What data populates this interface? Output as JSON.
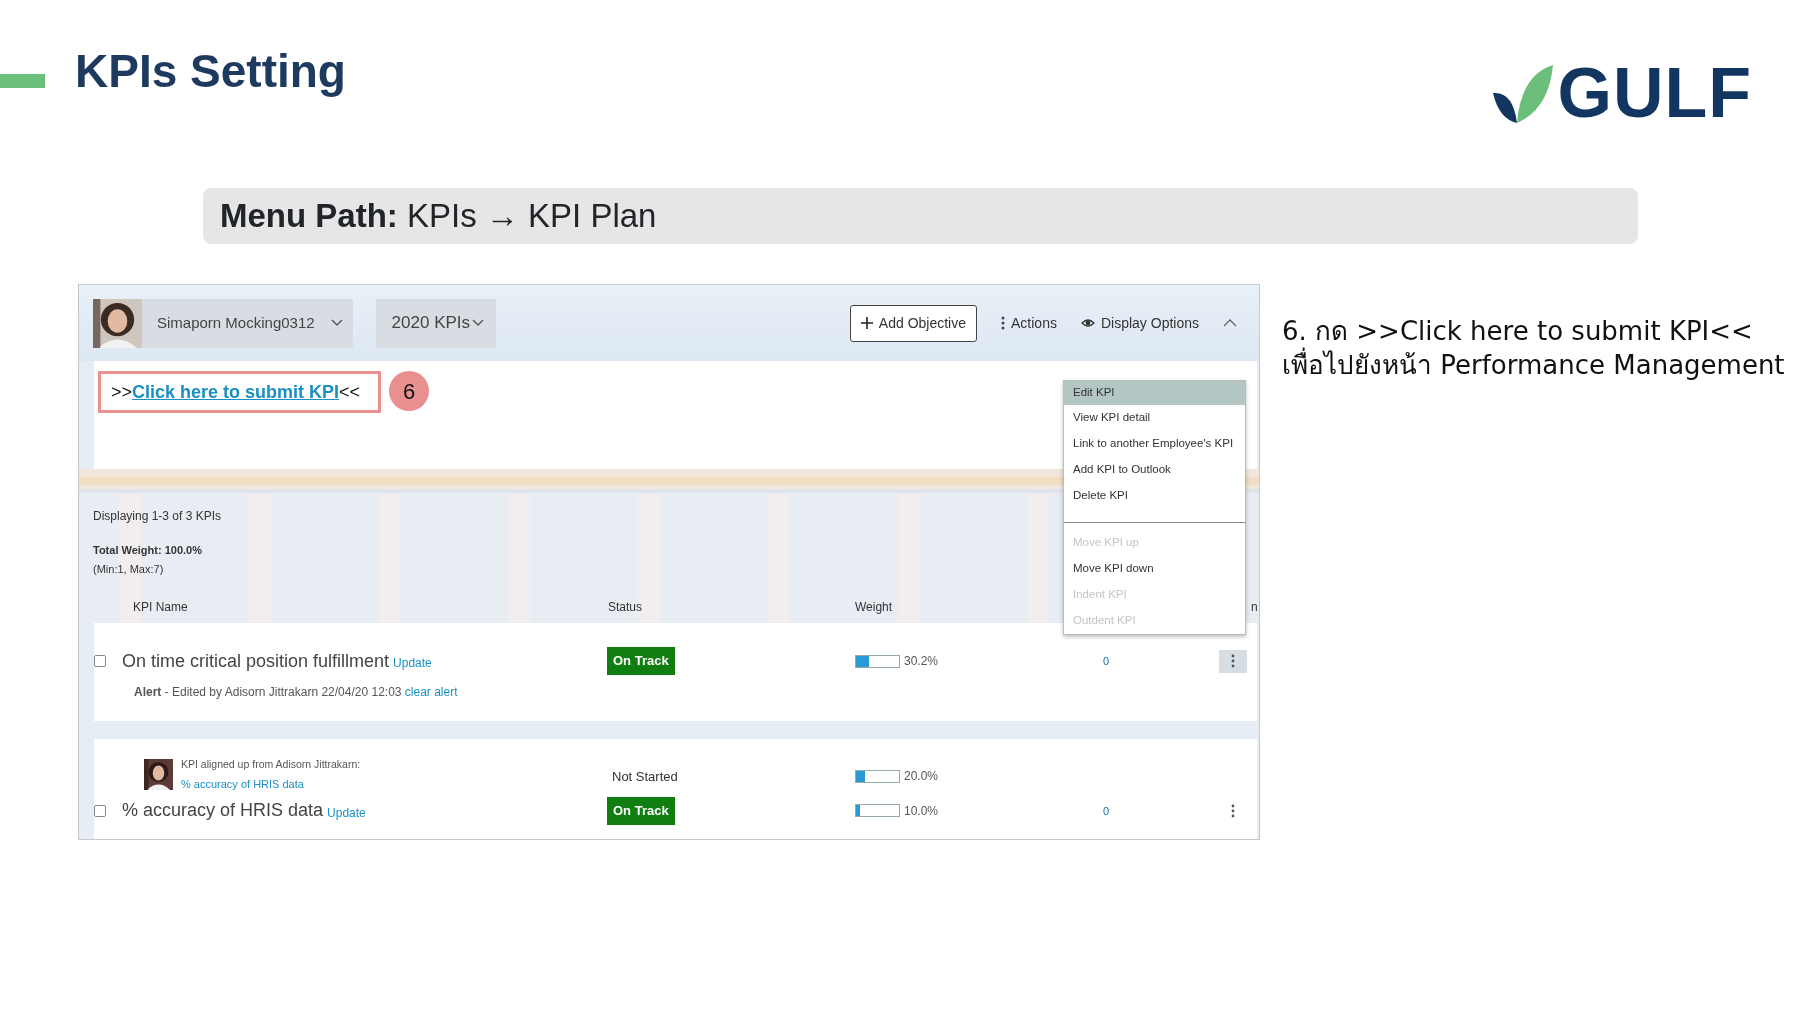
{
  "slide": {
    "title": "KPIs Setting",
    "logo": "GULF"
  },
  "menu_path": "**Menu Path:** KPIs → KPI Plan",
  "app": {
    "header": {
      "person": "Simaporn Mocking0312",
      "plan": "2020 KPIs",
      "add_button": "Add Objective",
      "actions": "Actions",
      "display_options": "Display Options",
      "expanded": true
    },
    "submit": {
      "prefix": ">>",
      "link": "Click here to submit KPI",
      "suffix": "<<",
      "step": "6"
    },
    "summary": {
      "displaying": "Displaying 1-3 of 3 KPIs",
      "total_weight": "Total Weight: 100.0%",
      "limits": "(Min:1, Max:7)"
    },
    "columns": [
      "KPI Name",
      "Status",
      "Weight",
      "n"
    ],
    "rows": [
      {
        "name": "On time critical position fulfillment",
        "update": "Update",
        "checked": false,
        "status": {
          "text": "On Track",
          "kind": "on_track"
        },
        "level": 0.302,
        "weight": "30.2%",
        "count": "0",
        "menu_open": true,
        "alert": {
          "label": "Alert",
          "text": " - Edited by Adisorn Jittrakarn 22/04/20 12:03 ",
          "link": "clear alert"
        }
      },
      {
        "aligned": {
          "text": "KPI aligned up from Adisorn Jittrakarn:",
          "link": "% accuracy of HRIS data",
          "status": {
            "text": "Not Started",
            "kind": "not_started"
          },
          "level": 0.2,
          "weight": "20.0%"
        },
        "name": "% accuracy of HRIS data",
        "update": "Update",
        "checked": false,
        "status": {
          "text": "On Track",
          "kind": "on_track"
        },
        "level": 0.1,
        "weight": "10.0%",
        "count": "0",
        "menu_open": false
      }
    ],
    "menu": {
      "groups": [
        [
          {
            "label": "Edit KPI",
            "selected": true,
            "disabled": false
          },
          {
            "label": "View KPI detail",
            "selected": false,
            "disabled": false
          },
          {
            "label": "Link to another Employee's KPI",
            "selected": false,
            "disabled": false
          },
          {
            "label": "Add KPI to Outlook",
            "selected": false,
            "disabled": false
          },
          {
            "label": "Delete KPI",
            "selected": false,
            "disabled": false
          }
        ],
        [
          {
            "label": "Move KPI up",
            "selected": false,
            "disabled": true
          },
          {
            "label": "Move KPI down",
            "selected": false,
            "disabled": false
          },
          {
            "label": "Indent KPI",
            "selected": false,
            "disabled": true
          },
          {
            "label": "Outdent KPI",
            "selected": false,
            "disabled": true
          }
        ]
      ]
    }
  },
  "instruction": [
    "6. กด >>Click here to submit KPI<<",
    "เพื่อไปยังหน้า Performance Management"
  ]
}
